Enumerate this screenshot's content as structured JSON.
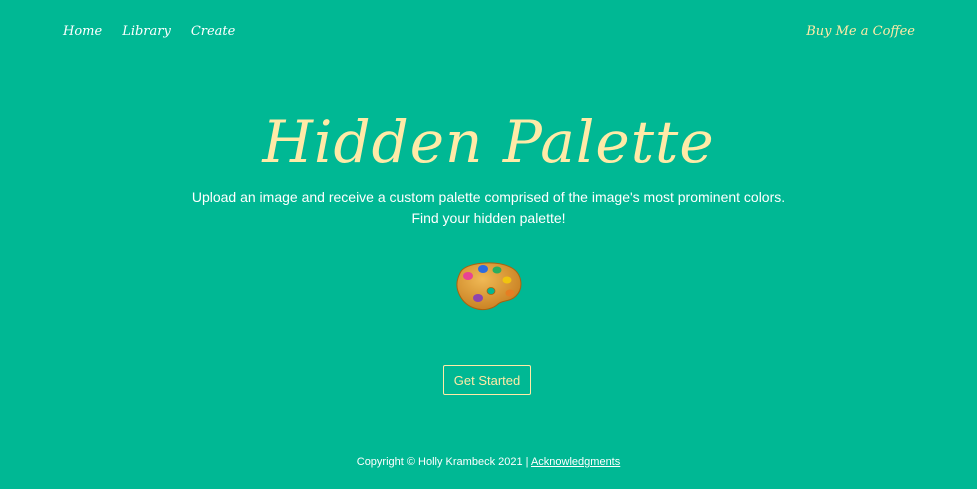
{
  "nav": {
    "items": [
      {
        "label": "Home"
      },
      {
        "label": "Library"
      },
      {
        "label": "Create"
      }
    ],
    "right_link": "Buy Me a Coffee"
  },
  "hero": {
    "title": "Hidden Palette",
    "subtitle_line1": "Upload an image and receive a custom palette comprised of the image's most prominent colors.",
    "subtitle_line2": "Find your hidden palette!",
    "icon": "artist-palette-icon",
    "cta_label": "Get Started"
  },
  "footer": {
    "copyright": "Copyright © Holly Krambeck 2021 |",
    "acknowledgments": "Acknowledgments"
  },
  "colors": {
    "background": "#00b894",
    "accent": "#ffeaa7",
    "text": "#ffffff"
  }
}
